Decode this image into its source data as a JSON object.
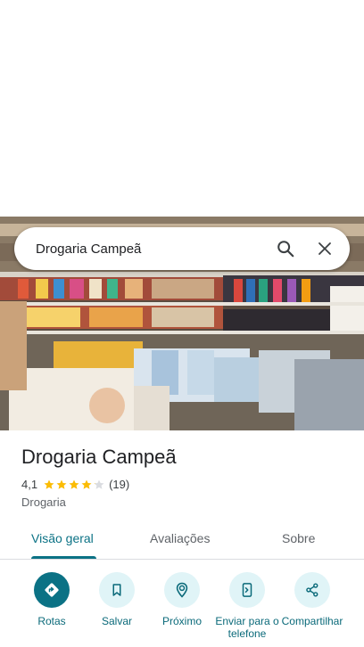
{
  "search": {
    "query": "Drogaria Campeã"
  },
  "place": {
    "name": "Drogaria Campeã",
    "rating": "4,1",
    "rating_value": 4.1,
    "review_count": "(19)",
    "category": "Drogaria"
  },
  "tabs": [
    {
      "label": "Visão geral",
      "active": true
    },
    {
      "label": "Avaliações",
      "active": false
    },
    {
      "label": "Sobre",
      "active": false
    }
  ],
  "actions": [
    {
      "label": "Rotas",
      "icon": "directions-icon"
    },
    {
      "label": "Salvar",
      "icon": "bookmark-icon"
    },
    {
      "label": "Próximo",
      "icon": "nearby-icon"
    },
    {
      "label": "Enviar para o telefone",
      "icon": "send-to-phone-icon"
    },
    {
      "label": "Compartilhar",
      "icon": "share-icon"
    }
  ],
  "colors": {
    "accent": "#0b7285",
    "accent_light": "#e0f4f7",
    "star": "#fbbc04",
    "star_empty": "#dadce0"
  }
}
